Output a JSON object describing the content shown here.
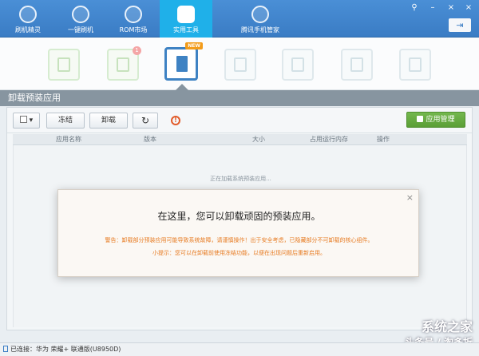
{
  "nav": {
    "items": [
      {
        "label": "刷机精灵"
      },
      {
        "label": "一键刷机"
      },
      {
        "label": "ROM市场"
      },
      {
        "label": "实用工具"
      },
      {
        "label": "腾讯手机管家"
      }
    ],
    "active_index": 3
  },
  "window": {
    "pin": "⚲",
    "minimize": "–",
    "close": "×",
    "arrow": "⇥"
  },
  "tools": {
    "badge_new": "NEW",
    "badge_count": "1"
  },
  "section": {
    "title": "卸载预装应用"
  },
  "toolbar": {
    "select_caret": "▾",
    "freeze_label": "冻结",
    "uninstall_label": "卸载",
    "refresh_icon": "↻",
    "warning_icon": "!",
    "app_manage_label": "应用管理"
  },
  "table": {
    "columns": [
      "应用名称",
      "版本",
      "大小",
      "占用运行内存",
      "操作"
    ],
    "loading_text": "正在加载系统预装应用..."
  },
  "modal": {
    "close": "×",
    "title": "在这里，您可以卸载顽固的预装应用。",
    "warning": "警告：卸载部分预装应用可能导致系统故障，请谨慎操作！出于安全考虑，已隐藏部分不可卸载的核心组件。",
    "tip": "小提示：您可以在卸载前使用冻结功能，以便在出现问题后重新启用。"
  },
  "status": {
    "text": "已连接：华为 荣耀+ 联通版(U8950D)"
  },
  "watermark": {
    "brand": "系统之家",
    "sub": "头条号 / 淘多折"
  },
  "colors": {
    "nav_bg": "#3a7cc4",
    "nav_active": "#1fb0e9",
    "accent_green": "#5a9e36",
    "warning_orange": "#e77b22"
  }
}
